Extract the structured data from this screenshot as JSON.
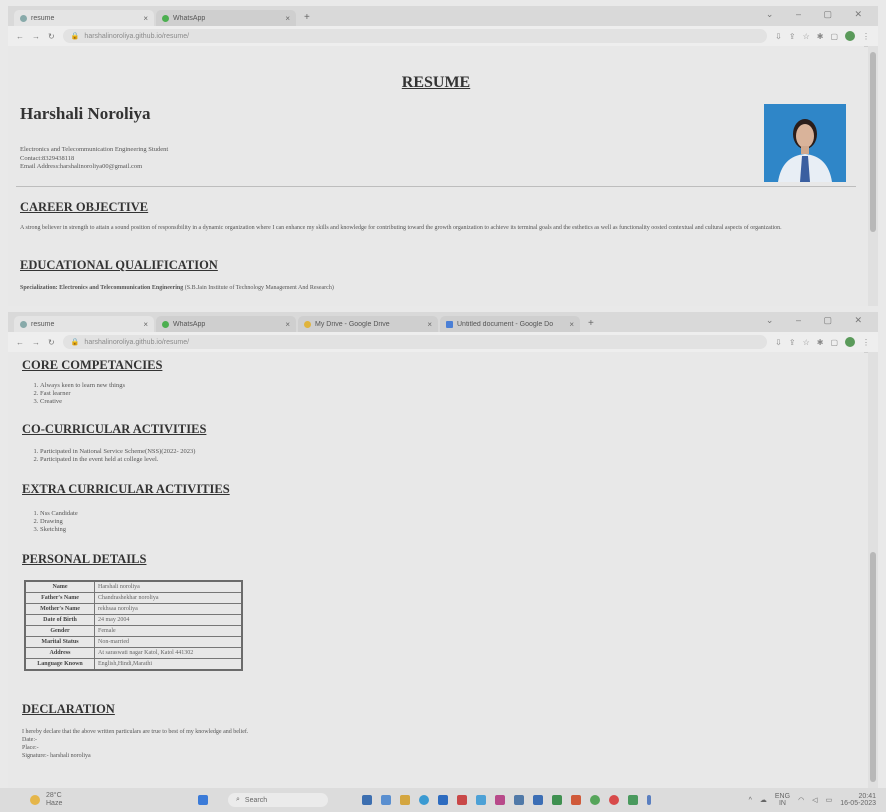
{
  "top_window": {
    "tabs": [
      {
        "label": "resume",
        "active": true
      },
      {
        "label": "WhatsApp",
        "active": false
      }
    ],
    "url": "harshalinoroliya.github.io/resume/"
  },
  "bottom_window": {
    "tabs": [
      {
        "label": "resume",
        "active": true
      },
      {
        "label": "WhatsApp",
        "active": false
      },
      {
        "label": "My Drive - Google Drive",
        "active": false
      },
      {
        "label": "Untitled document - Google Do",
        "active": false
      }
    ],
    "url": "harshalinoroliya.github.io/resume/"
  },
  "resume": {
    "heading": "RESUME",
    "name": "Harshali Noroliya",
    "info": [
      "Electronics and Telecommunication Engineering Student",
      "Contact:8329438118",
      "Email Address:harshalinoroliya00@gmail.com"
    ],
    "career_objective": {
      "title": "CAREER OBJECTIVE",
      "text": "A strong believer in strength to attain a sound position of responsibility in a dynamic organization where I can enhance my skills and knowledge for contributing toward the growth organization to achieve its terminal goals and the esthetics as well as functionality oosted contextual and cultural aspects of organization."
    },
    "education": {
      "title": "EDUCATIONAL QUALIFICATION",
      "label": "Specialization:  Electronics and Telecommunication Engineering",
      "institute": "(S.B.Jain Institute of Technology Management And Research)"
    },
    "core": {
      "title": "CORE COMPETANCIES",
      "items": [
        "Always keen to learn new things",
        "Fast learner",
        "Creative"
      ]
    },
    "cocurricular": {
      "title": "CO-CURRICULAR ACTIVITIES",
      "items": [
        "Participated in National Service Scheme(NSS)(2022- 2023)",
        "Participated in the event held at college level."
      ]
    },
    "extracurricular": {
      "title": "EXTRA CURRICULAR ACTIVITIES",
      "items": [
        "Nss Candidate",
        "Drawing",
        "Sketching"
      ]
    },
    "personal": {
      "title": "PERSONAL DETAILS",
      "rows": [
        {
          "k": "Name",
          "v": "Harshali noroliya"
        },
        {
          "k": "Father's Name",
          "v": "Chandrashekhar noroliya"
        },
        {
          "k": "Mother's Name",
          "v": "rekhsaa noroliya"
        },
        {
          "k": "Date of Birth",
          "v": "24 may 2004"
        },
        {
          "k": "Gender",
          "v": "Female"
        },
        {
          "k": "Marital Status",
          "v": "Non-married"
        },
        {
          "k": "Address",
          "v": "At saraswati nagar Katol, Katol 441302"
        },
        {
          "k": "Language Known",
          "v": "English,Hindi,Marathi"
        }
      ]
    },
    "declaration": {
      "title": "DECLARATION",
      "lines": [
        "I hereby declare that the above written particulars are true to best of my knowledge and belief.",
        "Date:-",
        "Place:-",
        "Signature:- harshali noroliya"
      ]
    }
  },
  "taskbar": {
    "weather_temp": "28°C",
    "weather_desc": "Haze",
    "search": "Search",
    "lang": "ENG",
    "region": "IN",
    "time": "20:41",
    "date": "16-05-2023"
  },
  "colors": {
    "photo_bg": "#2f86c8",
    "taskbar_bg": "#dcdcdc"
  }
}
